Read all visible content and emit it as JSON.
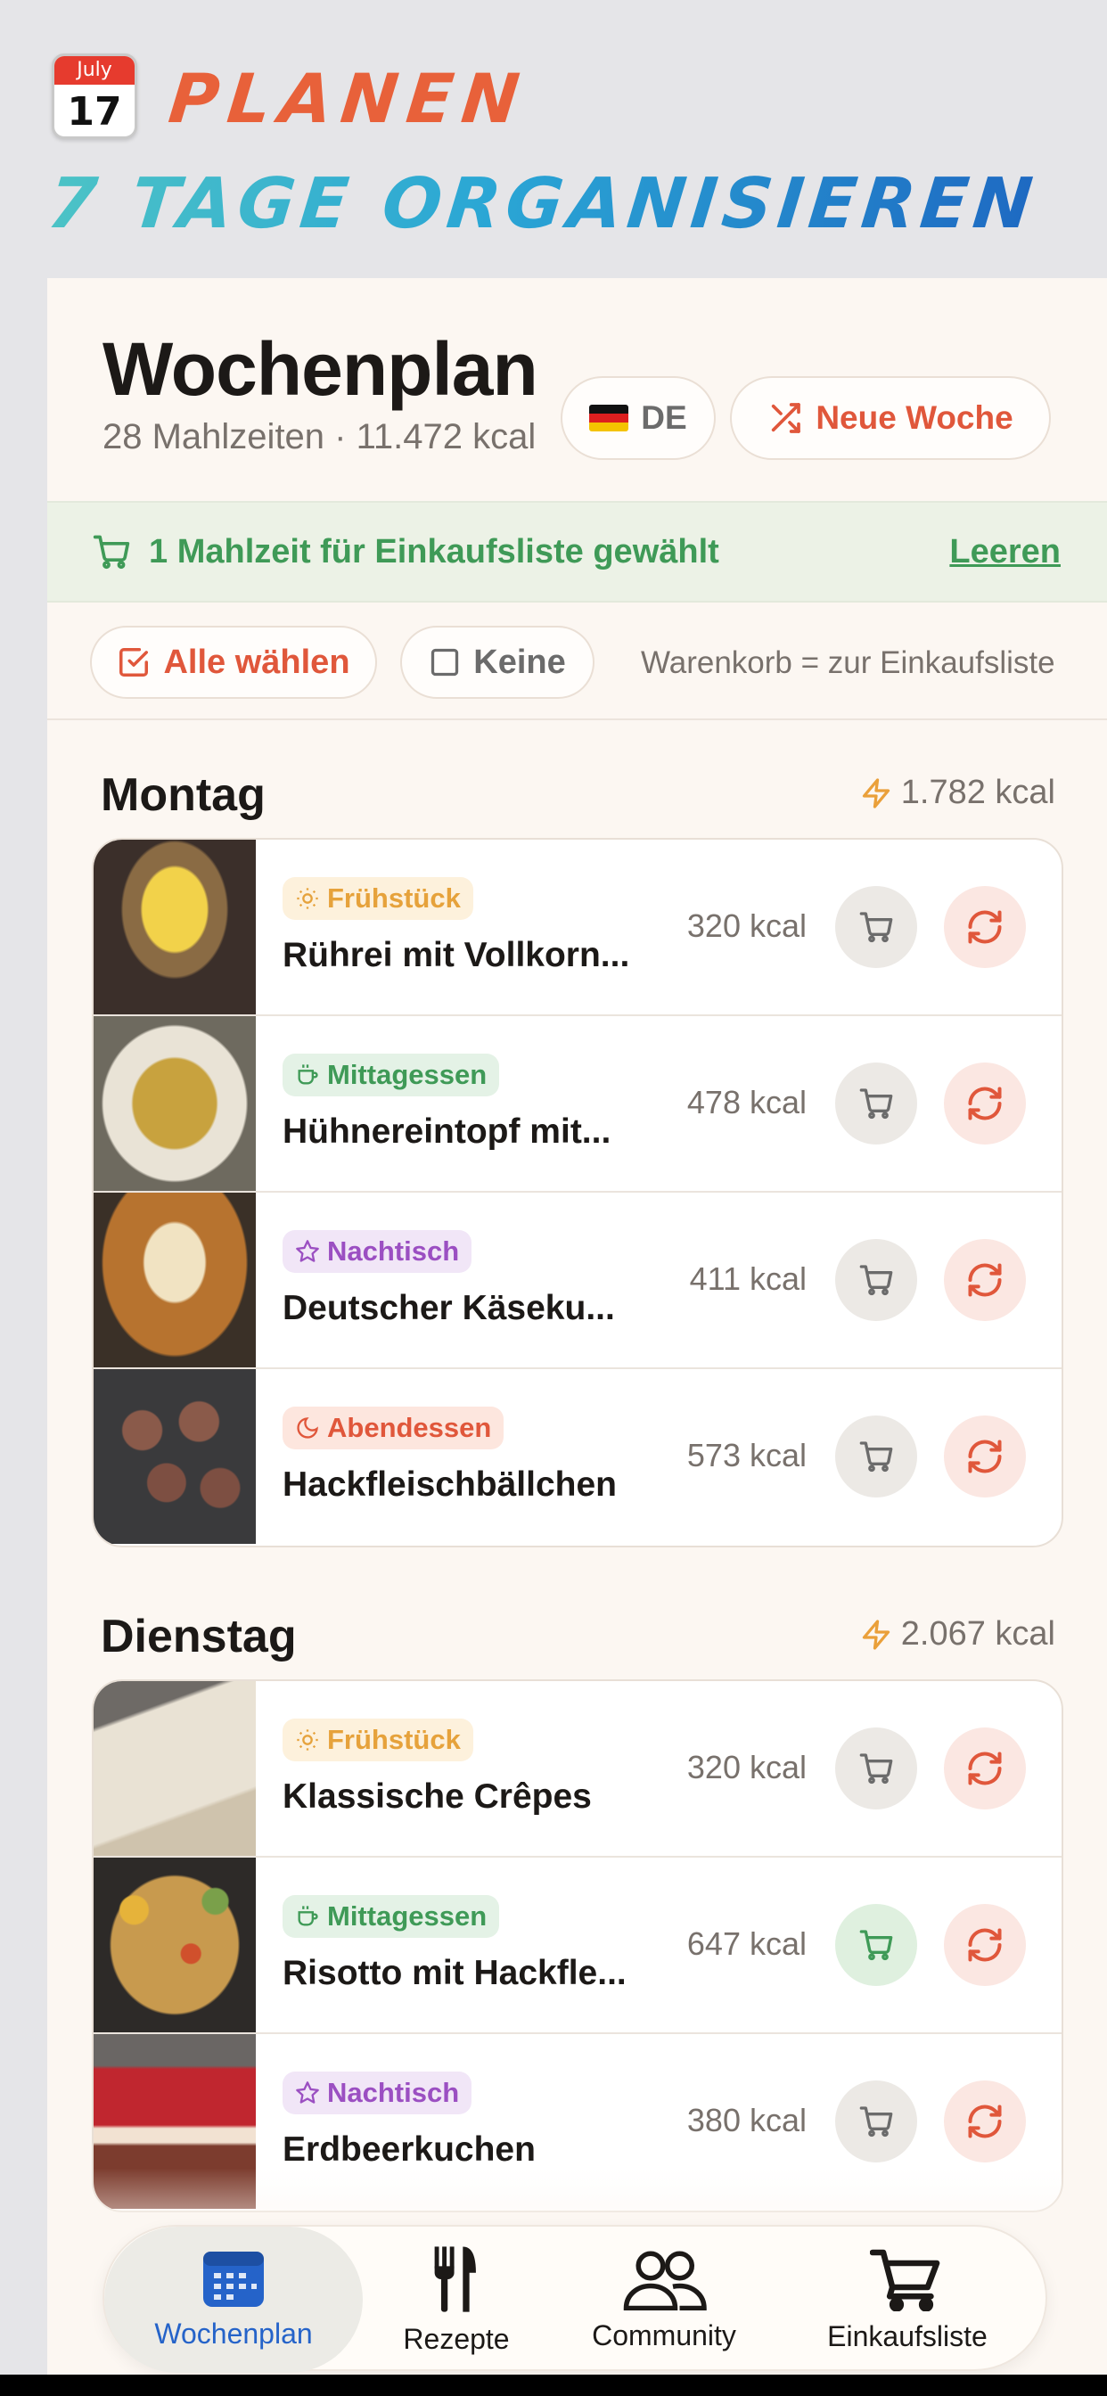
{
  "promo": {
    "calendar_month": "July",
    "calendar_day": "17",
    "title": "PLANEN",
    "subtitle": "7 TAGE ORGANISIEREN"
  },
  "header": {
    "title": "Wochenplan",
    "subtitle": "28 Mahlzeiten · 11.472 kcal",
    "lang_label": "DE",
    "new_week_label": "Neue Woche"
  },
  "shopping": {
    "message": "1 Mahlzeit für Einkaufsliste gewählt",
    "clear_label": "Leeren"
  },
  "selection": {
    "all_label": "Alle wählen",
    "none_label": "Keine",
    "hint": "Warenkorb = zur Einkaufsliste"
  },
  "days": [
    {
      "name": "Montag",
      "kcal": "1.782 kcal",
      "meals": [
        {
          "type": "Frühstück",
          "name": "Rührei mit Vollkorn...",
          "kcal": "320 kcal",
          "in_cart": false
        },
        {
          "type": "Mittagessen",
          "name": "Hühnereintopf mit...",
          "kcal": "478 kcal",
          "in_cart": false
        },
        {
          "type": "Nachtisch",
          "name": "Deutscher Käseku...",
          "kcal": "411 kcal",
          "in_cart": false
        },
        {
          "type": "Abendessen",
          "name": "Hackfleischbällchen",
          "kcal": "573 kcal",
          "in_cart": false
        }
      ]
    },
    {
      "name": "Dienstag",
      "kcal": "2.067 kcal",
      "meals": [
        {
          "type": "Frühstück",
          "name": "Klassische Crêpes",
          "kcal": "320 kcal",
          "in_cart": false
        },
        {
          "type": "Mittagessen",
          "name": "Risotto mit Hackfle...",
          "kcal": "647 kcal",
          "in_cart": true
        },
        {
          "type": "Nachtisch",
          "name": "Erdbeerkuchen",
          "kcal": "380 kcal",
          "in_cart": false
        }
      ]
    }
  ],
  "nav": {
    "items": [
      "Wochenplan",
      "Rezepte",
      "Community",
      "Einkaufsliste"
    ],
    "active": "Wochenplan"
  },
  "colors": {
    "accent": "#e0573b",
    "green": "#3f9a57",
    "nav_active": "#2563c9"
  }
}
